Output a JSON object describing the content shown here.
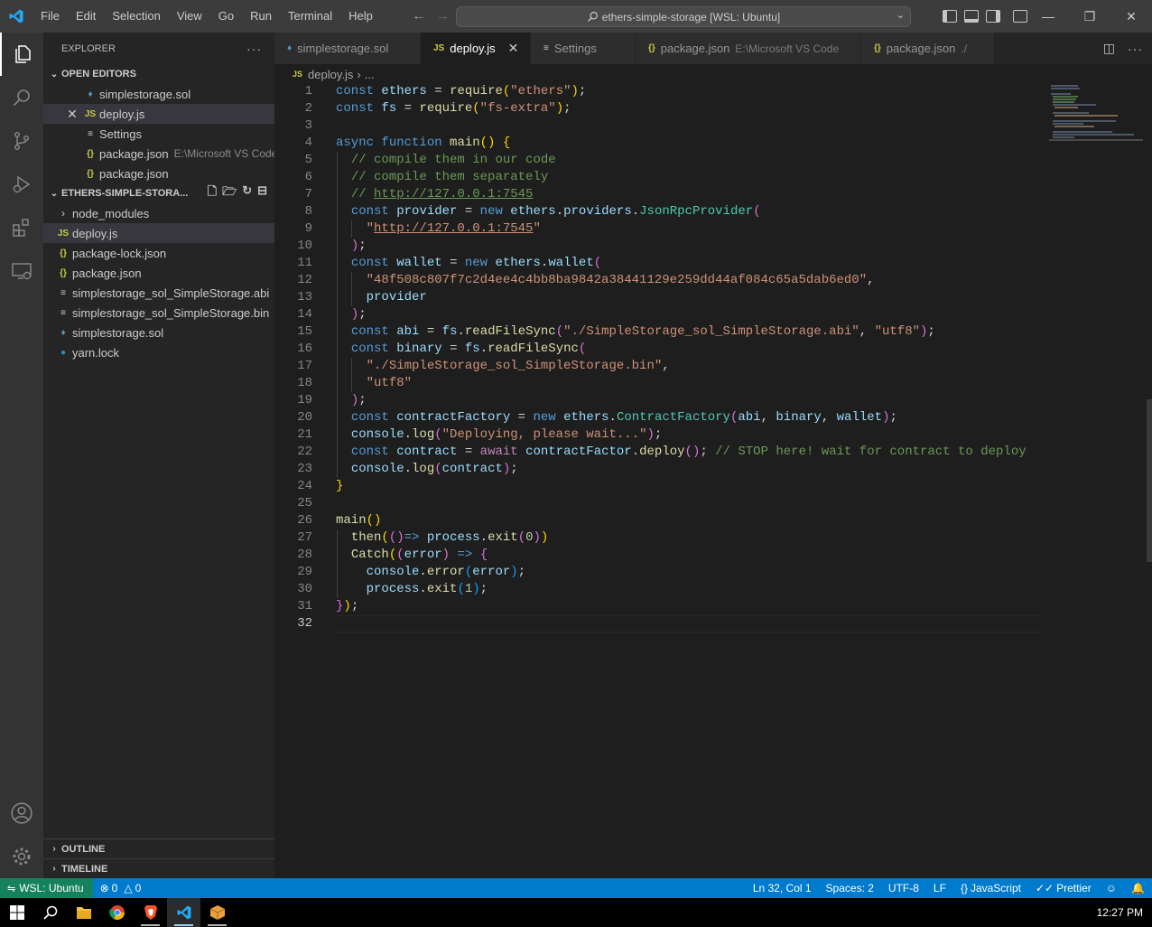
{
  "titlebar": {
    "menu": [
      "File",
      "Edit",
      "Selection",
      "View",
      "Go",
      "Run",
      "Terminal",
      "Help"
    ],
    "command_center": "ethers-simple-storage [WSL: Ubuntu]"
  },
  "explorer": {
    "header": "EXPLORER",
    "open_editors_title": "OPEN EDITORS",
    "open_editors": [
      {
        "name": "simplestorage.sol",
        "desc": "",
        "icon": "solidity-icon"
      },
      {
        "name": "deploy.js",
        "desc": "",
        "icon": "js-icon"
      },
      {
        "name": "Settings",
        "desc": "",
        "icon": "settings-icon"
      },
      {
        "name": "package.json",
        "desc": "E:\\Microsoft VS Code",
        "icon": "json-icon"
      },
      {
        "name": "package.json",
        "desc": "",
        "icon": "json-icon"
      }
    ],
    "project_title": "ETHERS-SIMPLE-STORA...",
    "files": [
      {
        "name": "node_modules",
        "icon": "chevron-right-icon"
      },
      {
        "name": "deploy.js",
        "icon": "js-icon"
      },
      {
        "name": "package-lock.json",
        "icon": "json-icon"
      },
      {
        "name": "package.json",
        "icon": "json-icon"
      },
      {
        "name": "simplestorage_sol_SimpleStorage.abi",
        "icon": "file-icon"
      },
      {
        "name": "simplestorage_sol_SimpleStorage.bin",
        "icon": "file-icon"
      },
      {
        "name": "simplestorage.sol",
        "icon": "solidity-icon"
      },
      {
        "name": "yarn.lock",
        "icon": "yarn-icon"
      }
    ],
    "outline": "OUTLINE",
    "timeline": "TIMELINE"
  },
  "tabs": [
    {
      "label": "simplestorage.sol",
      "desc": ""
    },
    {
      "label": "deploy.js",
      "desc": ""
    },
    {
      "label": "Settings",
      "desc": ""
    },
    {
      "label": "package.json",
      "desc": "E:\\Microsoft VS Code"
    },
    {
      "label": "package.json",
      "desc": "./"
    }
  ],
  "breadcrumb": {
    "file": "deploy.js",
    "rest": "..."
  },
  "editor": {
    "line_numbers": [
      "1",
      "2",
      "3",
      "4",
      "5",
      "6",
      "7",
      "8",
      "9",
      "10",
      "11",
      "12",
      "13",
      "14",
      "15",
      "16",
      "17",
      "18",
      "19",
      "20",
      "21",
      "22",
      "23",
      "24",
      "25",
      "26",
      "27",
      "28",
      "29",
      "30",
      "31",
      "32"
    ],
    "current_line": "32"
  },
  "statusbar": {
    "remote": "WSL: Ubuntu",
    "errors": "0",
    "warnings": "0",
    "position": "Ln 32, Col 1",
    "spaces": "Spaces: 2",
    "encoding": "UTF-8",
    "eol": "LF",
    "language": "JavaScript",
    "formatter": "Prettier"
  },
  "taskbar": {
    "clock": "12:27 PM"
  },
  "colors": {
    "accent": "#007acc",
    "remote": "#16825d",
    "keyword": "#569cd6",
    "string": "#ce9178",
    "comment": "#6a9955"
  }
}
